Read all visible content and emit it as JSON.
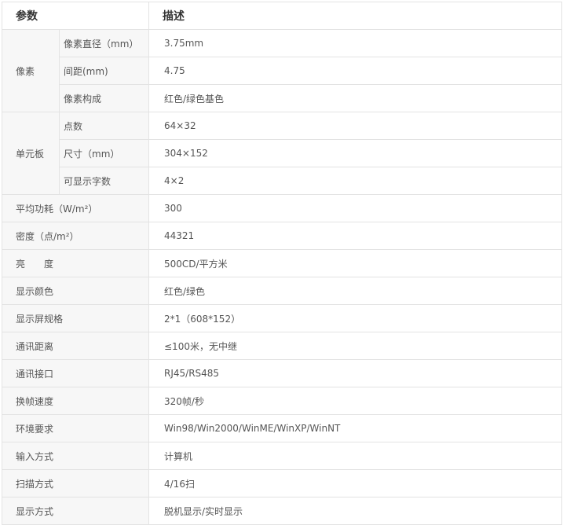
{
  "header": {
    "param": "参数",
    "desc": "描述"
  },
  "groups": [
    {
      "name": "像素",
      "rows": [
        {
          "label": "像素直径（mm）",
          "value": "3.75mm"
        },
        {
          "label": "间距(mm)",
          "value": "4.75"
        },
        {
          "label": "像素构成",
          "value": "红色/绿色基色"
        }
      ]
    },
    {
      "name": "单元板",
      "rows": [
        {
          "label": "点数",
          "value": "64×32"
        },
        {
          "label": "尺寸（mm）",
          "value": "304×152"
        },
        {
          "label": "可显示字数",
          "value": "4×2"
        }
      ]
    }
  ],
  "rows": [
    {
      "label": "平均功耗（W/m²）",
      "value": "300"
    },
    {
      "label": "密度（点/m²）",
      "value": "44321"
    },
    {
      "label": "亮　　度",
      "value": "500CD/平方米"
    },
    {
      "label": "显示颜色",
      "value": "红色/绿色"
    },
    {
      "label": "显示屏规格",
      "value": "2*1（608*152）"
    },
    {
      "label": "通讯距离",
      "value": "≤100米，无中继"
    },
    {
      "label": "通讯接口",
      "value": "RJ45/RS485"
    },
    {
      "label": "换帧速度",
      "value": "320帧/秒"
    },
    {
      "label": "环境要求",
      "value": "Win98/Win2000/WinME/WinXP/WinNT"
    },
    {
      "label": "输入方式",
      "value": "计算机"
    },
    {
      "label": "扫描方式",
      "value": "4/16扫"
    },
    {
      "label": "显示方式",
      "value": "脱机显示/实时显示"
    }
  ]
}
